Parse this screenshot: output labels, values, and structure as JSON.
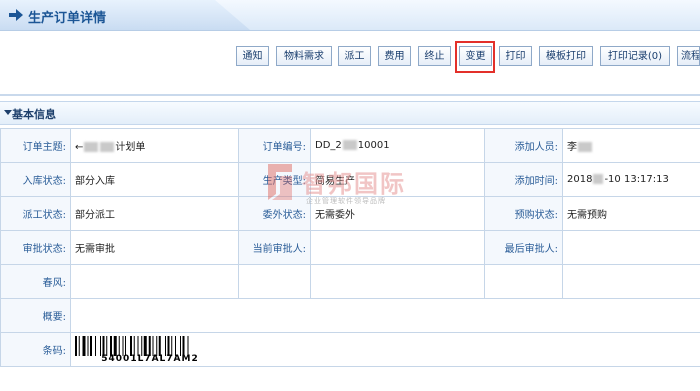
{
  "header": {
    "title": "生产订单详情"
  },
  "toolbar": {
    "buttons": [
      {
        "label": "通知"
      },
      {
        "label": "物料需求"
      },
      {
        "label": "派工"
      },
      {
        "label": "费用"
      },
      {
        "label": "终止"
      },
      {
        "label": "变更"
      },
      {
        "label": "打印"
      },
      {
        "label": "模板打印"
      },
      {
        "label": "打印记录(0)"
      },
      {
        "label": "流程"
      }
    ]
  },
  "section": {
    "title": "基本信息"
  },
  "fields": {
    "subject": {
      "label": "订单主题:",
      "value_suffix": "计划单"
    },
    "order_no": {
      "label": "订单编号:",
      "value_prefix": "DD_2",
      "value_suffix": "10001"
    },
    "creator": {
      "label": "添加人员:",
      "value_prefix": "李"
    },
    "stock_status": {
      "label": "入库状态:",
      "value": "部分入库"
    },
    "prod_type": {
      "label": "生产类型:",
      "value": "简易生产"
    },
    "add_time": {
      "label": "添加时间:",
      "value_prefix": "2018",
      "value_suffix": "-10 13:17:13"
    },
    "dispatch_status": {
      "label": "派工状态:",
      "value": "部分派工"
    },
    "outsource_status": {
      "label": "委外状态:",
      "value": "无需委外"
    },
    "purchase_status": {
      "label": "预购状态:",
      "value": "无需预购"
    },
    "approve_status": {
      "label": "审批状态:",
      "value": "无需审批"
    },
    "current_approver": {
      "label": "当前审批人:",
      "value": ""
    },
    "last_approver": {
      "label": "最后审批人:",
      "value": ""
    },
    "chunfeng": {
      "label": "春风:",
      "value": ""
    },
    "summary": {
      "label": "概要:",
      "value": ""
    },
    "barcode": {
      "label": "条码:",
      "value": "54001L7AL7AM2"
    }
  },
  "watermark": {
    "name": "智邦国际",
    "slogan": "企业管理软件领导品牌"
  },
  "colors": {
    "accent": "#1c5696",
    "highlight": "#e3302a",
    "label": "#2a5d98"
  }
}
